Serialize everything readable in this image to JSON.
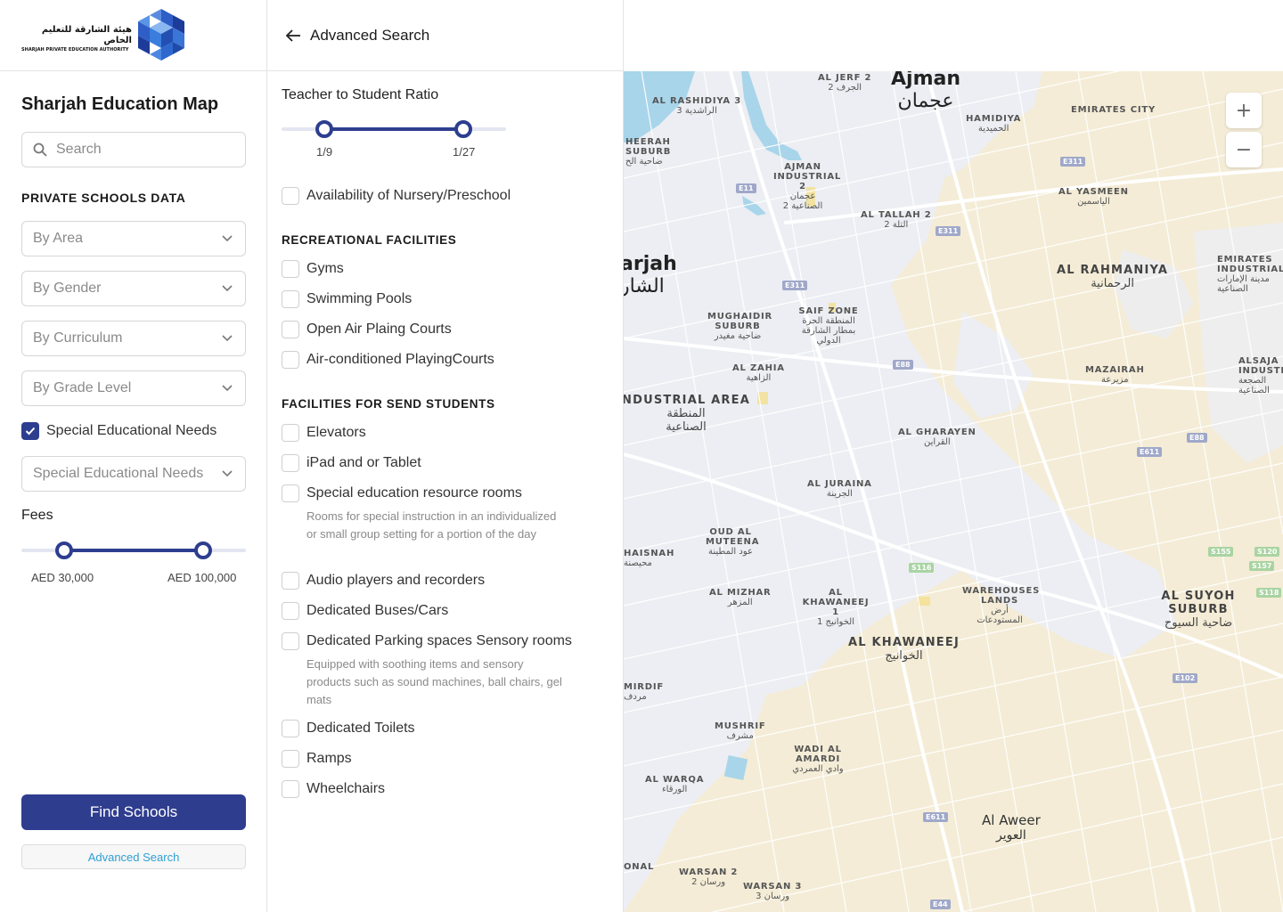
{
  "brand": {
    "name_ar": "هيئة الشارقة للتعليم الخاص",
    "name_en": "SHARJAH PRIVATE EDUCATION AUTHORITY"
  },
  "sidebar": {
    "title": "Sharjah Education Map",
    "search_placeholder": "Search",
    "section_title": "PRIVATE SCHOOLS DATA",
    "filters": [
      {
        "label": "By Area"
      },
      {
        "label": "By Gender"
      },
      {
        "label": "By Curriculum"
      },
      {
        "label": "By Grade Level"
      }
    ],
    "sen_checkbox": {
      "label": "Special Educational Needs",
      "checked": true
    },
    "sen_select": {
      "label": "Special Educational Needs"
    },
    "fees": {
      "label": "Fees",
      "min_label": "AED 30,000",
      "max_label": "AED 100,000",
      "low_fraction": 0.19,
      "high_fraction": 0.81
    },
    "find_button": "Find Schools",
    "advanced_button": "Advanced Search"
  },
  "panel": {
    "title": "Advanced Search",
    "ratio": {
      "label": "Teacher to Student Ratio",
      "min_label": "1/9",
      "max_label": "1/27",
      "low_fraction": 0.19,
      "high_fraction": 0.81
    },
    "nursery": {
      "label": "Availability of Nursery/Preschool",
      "checked": false
    },
    "recreational": {
      "title": "RECREATIONAL FACILITIES",
      "items": [
        {
          "label": "Gyms"
        },
        {
          "label": "Swimming Pools"
        },
        {
          "label": "Open Air Plaing Courts"
        },
        {
          "label": "Air-conditioned PlayingCourts"
        }
      ]
    },
    "send": {
      "title": "FACILITIES FOR SEND STUDENTS",
      "items": [
        {
          "label": "Elevators"
        },
        {
          "label": "iPad and or Tablet"
        },
        {
          "label": "Special education resource rooms",
          "desc": "Rooms for special instruction in an individualized or small group setting for a portion of the day"
        },
        {
          "label": "Audio players and recorders"
        },
        {
          "label": "Dedicated Buses/Cars"
        },
        {
          "label": "Dedicated Parking spaces Sensory rooms",
          "desc": "Equipped with soothing items and sensory products such as sound machines, ball chairs, gel mats"
        },
        {
          "label": "Dedicated Toilets"
        },
        {
          "label": "Ramps"
        },
        {
          "label": "Wheelchairs"
        }
      ]
    }
  },
  "map": {
    "zoom_in": "+",
    "zoom_out": "−",
    "colors": {
      "land": "#f4ecd6",
      "urban": "#eceef3",
      "water": "#a8d5ea",
      "road": "#ffffff"
    },
    "places": [
      {
        "en": "Ajman",
        "ar": "عجمان"
      },
      {
        "en": "arjah",
        "ar": "الشار"
      },
      {
        "en": "AL JERF 2",
        "ar": "الجرف 2"
      },
      {
        "en": "AL RASHIDIYA 3",
        "ar": "الراشدية 3"
      },
      {
        "en": "HAMIDIYA",
        "ar": "الحميدية"
      },
      {
        "en": "EMIRATES CITY",
        "ar": ""
      },
      {
        "en": "HEERAH SUBURB",
        "ar": "ضاحية الح"
      },
      {
        "en": "AJMAN INDUSTRIAL 2",
        "ar": "عجمان الصناعية 2"
      },
      {
        "en": "AL YASMEEN",
        "ar": "الياسمين"
      },
      {
        "en": "AL TALLAH 2",
        "ar": "التلة 2"
      },
      {
        "en": "AL RAHMANIYA",
        "ar": "الرحمانية"
      },
      {
        "en": "EMIRATES INDUSTRIAL",
        "ar": "مدينة الإمارات الصناعية"
      },
      {
        "en": "MUGHAIDIR SUBURB",
        "ar": "ضاحية مغيدر"
      },
      {
        "en": "SAIF ZONE",
        "ar": "المنطقة الحرة بمطار الشارقة الدولي"
      },
      {
        "en": "AL ZAHIA",
        "ar": "الزاهية"
      },
      {
        "en": "MAZAIRAH",
        "ar": "مزيرعة"
      },
      {
        "en": "ALSAJA INDUSTR",
        "ar": "الصجعة الصناعية"
      },
      {
        "en": "NDUSTRIAL AREA",
        "ar": "المنطقة الصناعية"
      },
      {
        "en": "AL GHARAYEN",
        "ar": "القراين"
      },
      {
        "en": "AL JURAINA",
        "ar": "الجرينة"
      },
      {
        "en": "OUD AL MUTEENA",
        "ar": "عود المطينة"
      },
      {
        "en": "HAISNAH",
        "ar": "محيصنة"
      },
      {
        "en": "AL MIZHAR",
        "ar": "المزهر"
      },
      {
        "en": "AL KHAWANEEJ 1",
        "ar": "الخوانيج 1"
      },
      {
        "en": "WAREHOUSES LANDS",
        "ar": "أرض المستودعات"
      },
      {
        "en": "AL SUYOH SUBURB",
        "ar": "ضاحية السيوح"
      },
      {
        "en": "AL KHAWANEEJ",
        "ar": "الخوانيج"
      },
      {
        "en": "MIRDIF",
        "ar": "مردف"
      },
      {
        "en": "MUSHRIF",
        "ar": "مشرف"
      },
      {
        "en": "WADI AL AMARDI",
        "ar": "وادي العمردي"
      },
      {
        "en": "AL WARQA",
        "ar": "الورقاء"
      },
      {
        "en": "Al Aweer",
        "ar": "العوير"
      },
      {
        "en": "ONAL",
        "ar": ""
      },
      {
        "en": "WARSAN 2",
        "ar": "ورسان 2"
      },
      {
        "en": "WARSAN 3",
        "ar": "ورسان 3"
      }
    ],
    "shields": [
      "E311",
      "E11",
      "E311",
      "E311",
      "E88",
      "E88",
      "E611",
      "S116",
      "S155",
      "S120",
      "S157",
      "S118",
      "E102",
      "E611",
      "E44",
      "1"
    ]
  }
}
